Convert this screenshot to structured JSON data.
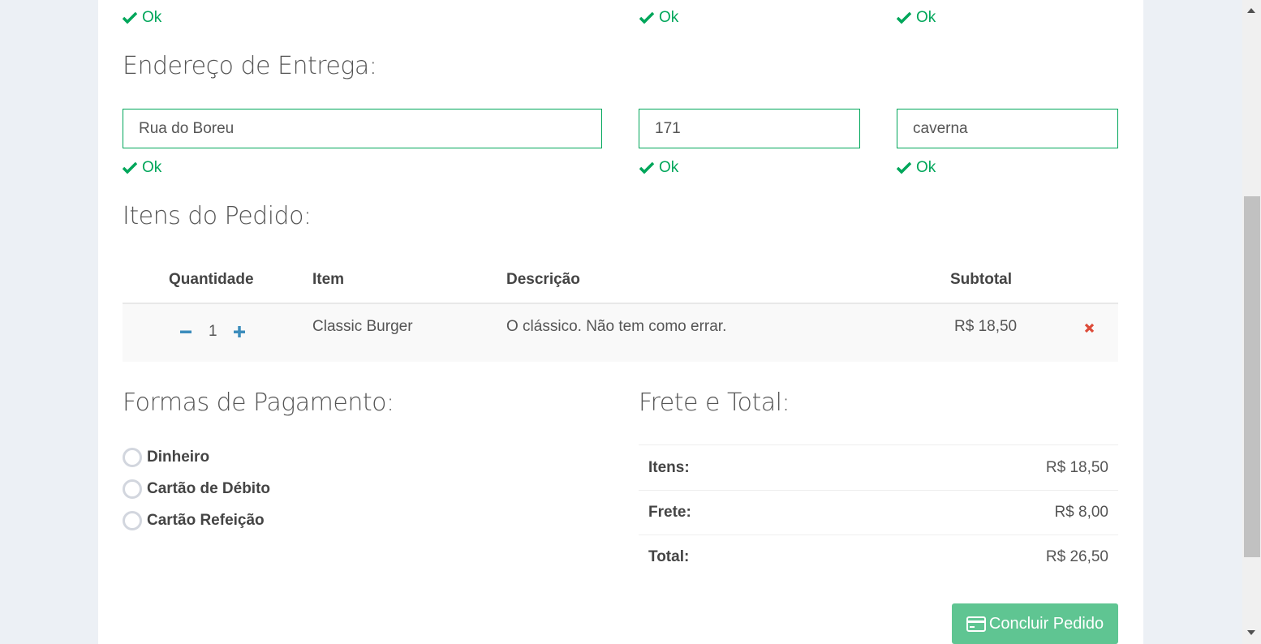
{
  "validation": {
    "ok_label": "Ok"
  },
  "address": {
    "title": "Endereço de Entrega:",
    "street": "Rua do Boreu",
    "number": "171",
    "complement": "caverna"
  },
  "order": {
    "title": "Itens do Pedido:",
    "columns": [
      "Quantidade",
      "Item",
      "Descrição",
      "Subtotal"
    ],
    "rows": [
      {
        "quantity": "1",
        "item": "Classic Burger",
        "description": "O clássico. Não tem como errar.",
        "subtotal": "R$ 18,50"
      }
    ]
  },
  "payment": {
    "title": "Formas de Pagamento:",
    "options": [
      "Dinheiro",
      "Cartão de Débito",
      "Cartão Refeição"
    ]
  },
  "totals": {
    "title": "Frete e Total:",
    "items_label": "Itens:",
    "items_value": "R$ 18,50",
    "freight_label": "Frete:",
    "freight_value": "R$ 8,00",
    "total_label": "Total:",
    "total_value": "R$ 26,50"
  },
  "submit_label": "Concluir Pedido",
  "colors": {
    "success": "#00a65a",
    "accent": "#3c8dbc",
    "danger": "#dd4b39",
    "button": "#5fc592"
  },
  "icons": [
    "check-icon",
    "minus-icon",
    "plus-icon",
    "remove-icon",
    "credit-card-icon"
  ]
}
